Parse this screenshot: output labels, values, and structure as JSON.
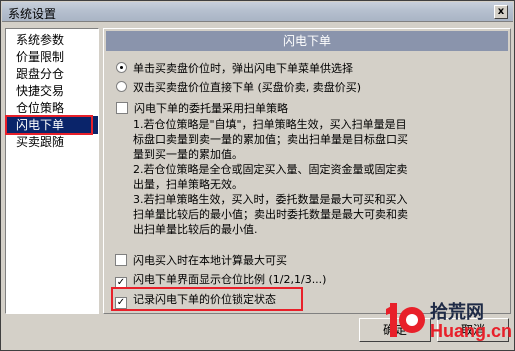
{
  "window": {
    "title": "系统设置",
    "close_label": "x"
  },
  "sidebar": {
    "items": [
      {
        "label": "系统参数",
        "selected": false
      },
      {
        "label": "价量限制",
        "selected": false
      },
      {
        "label": "跟盘分仓",
        "selected": false
      },
      {
        "label": "快捷交易",
        "selected": false
      },
      {
        "label": "仓位策略",
        "selected": false
      },
      {
        "label": "闪电下单",
        "selected": true
      },
      {
        "label": "买卖跟随",
        "selected": false
      }
    ]
  },
  "panel": {
    "header": "闪电下单",
    "radio_options": [
      {
        "label": "单击买卖盘价位时，弹出闪电下单菜单供选择",
        "checked": true
      },
      {
        "label": "双击买卖盘价位直接下单 (买盘价卖, 卖盘价买)",
        "checked": false
      }
    ],
    "scan_checkbox": {
      "label": "闪电下单的委托量采用扫单策略",
      "checked": false
    },
    "description": [
      "1.若仓位策略是\"自填\"，扫单策略生效，买入扫单量是目标盘口卖量到卖一量的累加值；卖出扫单量是目标盘口买量到买一量的累加值。",
      "2.若仓位策略是全仓或固定买入量、固定资金量或固定卖出量，扫单策略无效。",
      "3.若扫单策略生效，买入时，委托数量是最大可买和买入扫单量比较后的最小值；卖出时委托数量是最大可卖和卖出扫单量比较后的最小值."
    ],
    "bottom_checkboxes": [
      {
        "label": "闪电买入时在本地计算最大可买",
        "checked": false
      },
      {
        "label": "闪电下单界面显示仓位比例 (1/2,1/3...)",
        "checked": true
      },
      {
        "label": "记录闪电下单的价位锁定状态",
        "checked": true
      }
    ]
  },
  "buttons": {
    "ok": "确定",
    "cancel": "取消"
  },
  "watermark": {
    "cn": "拾荒网",
    "en": "Huang.cn",
    "logo_digits": "10"
  },
  "colors": {
    "highlight": "#e8202a",
    "selection": "#0a246a",
    "header": "#8a94ac"
  }
}
